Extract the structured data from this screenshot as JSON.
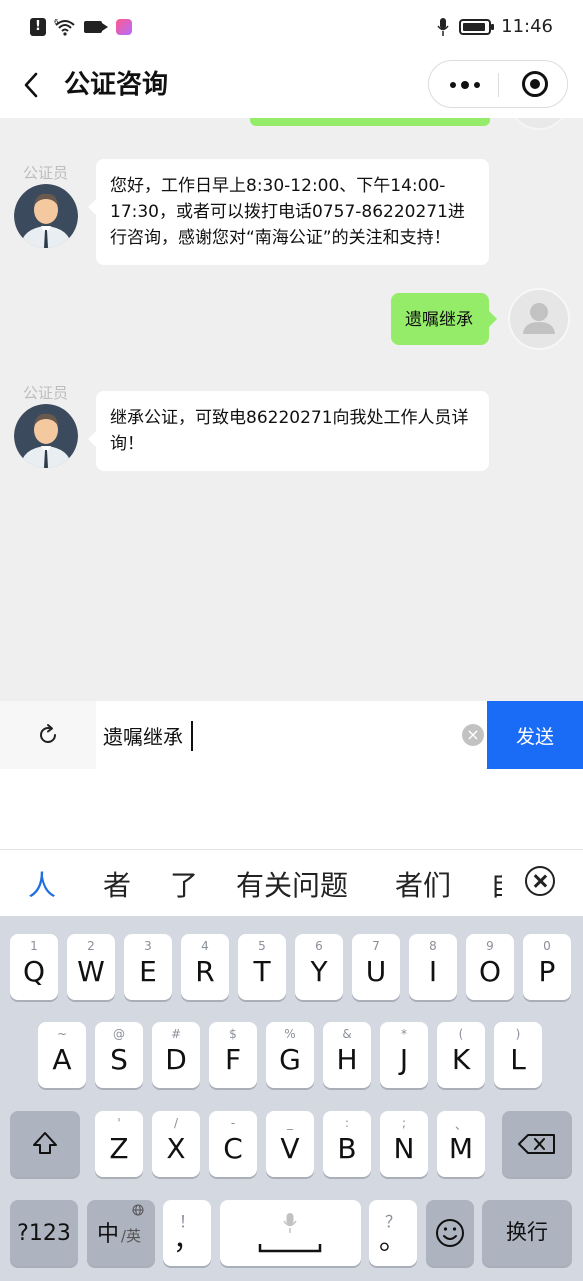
{
  "status_bar": {
    "time": "11:46",
    "network_badge": "6"
  },
  "nav": {
    "title": "公证咨询"
  },
  "messages": [
    {
      "sender": "公证员",
      "text": "您好，工作日早上8:30-12:00、下午14:00-17:30，或者可以拨打电话0757-86220271进行咨询，感谢您对“南海公证”的关注和支持！"
    },
    {
      "sender": "me",
      "text": "遗嘱继承"
    },
    {
      "sender": "公证员",
      "text": "继承公证，可致电86220271向我处工作人员详询！"
    }
  ],
  "input": {
    "value": "遗嘱继承",
    "send_label": "发送"
  },
  "candidates": [
    "人",
    "者",
    "了",
    "有关问题",
    "者们",
    "自"
  ],
  "keyboard": {
    "row1": [
      {
        "main": "Q",
        "sub": "1"
      },
      {
        "main": "W",
        "sub": "2"
      },
      {
        "main": "E",
        "sub": "3"
      },
      {
        "main": "R",
        "sub": "4"
      },
      {
        "main": "T",
        "sub": "5"
      },
      {
        "main": "Y",
        "sub": "6"
      },
      {
        "main": "U",
        "sub": "7"
      },
      {
        "main": "I",
        "sub": "8"
      },
      {
        "main": "O",
        "sub": "9"
      },
      {
        "main": "P",
        "sub": "0"
      }
    ],
    "row2": [
      {
        "main": "A",
        "sub": "~"
      },
      {
        "main": "S",
        "sub": "@"
      },
      {
        "main": "D",
        "sub": "#"
      },
      {
        "main": "F",
        "sub": "$"
      },
      {
        "main": "G",
        "sub": "%"
      },
      {
        "main": "H",
        "sub": "&"
      },
      {
        "main": "J",
        "sub": "*"
      },
      {
        "main": "K",
        "sub": "("
      },
      {
        "main": "L",
        "sub": ")"
      }
    ],
    "row3": [
      {
        "main": "Z",
        "sub": "'"
      },
      {
        "main": "X",
        "sub": "/"
      },
      {
        "main": "C",
        "sub": "-"
      },
      {
        "main": "V",
        "sub": "_"
      },
      {
        "main": "B",
        "sub": ":"
      },
      {
        "main": "N",
        "sub": ";"
      },
      {
        "main": "M",
        "sub": "、"
      }
    ],
    "row4": {
      "num_label": "?123",
      "lang_main": "中",
      "lang_sub": "/英",
      "comma_main": "，",
      "comma_sub": "！",
      "period_main": "。",
      "period_sub": "？",
      "enter_label": "换行"
    }
  }
}
